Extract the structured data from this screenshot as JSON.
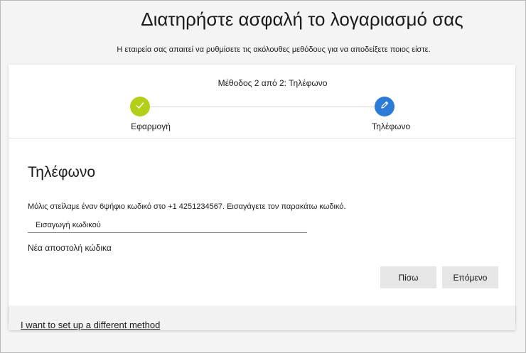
{
  "page": {
    "title": "Διατηρήστε ασφαλή το λογαριασμό σας",
    "subtitle": "Η εταιρεία σας απαιτεί να ρυθμίσετε τις ακόλουθες μεθόδους για να αποδείξετε ποιος είστε."
  },
  "wizard": {
    "step_caption": "Μέθοδος 2 από 2: Τηλέφωνο",
    "steps": [
      {
        "label": "Εφαρμογή",
        "status": "completed",
        "icon": "check-icon",
        "color": "#b3cf18"
      },
      {
        "label": "Τηλέφωνο",
        "status": "current",
        "icon": "pencil-icon",
        "color": "#2c7bd6"
      }
    ]
  },
  "form": {
    "section_title": "Τηλέφωνο",
    "instruction": "Μόλις στείλαμε έναν 6ψήφιο κωδικό στο +1 4251234567. Εισαγάγετε τον παρακάτω κωδικό.",
    "code_placeholder": "Εισαγωγή κωδικού",
    "code_value": "",
    "resend_label": "Νέα αποστολή κώδικα",
    "back_label": "Πίσω",
    "next_label": "Επόμενο"
  },
  "footer": {
    "alt_method_link": "I want to set up a different method"
  }
}
